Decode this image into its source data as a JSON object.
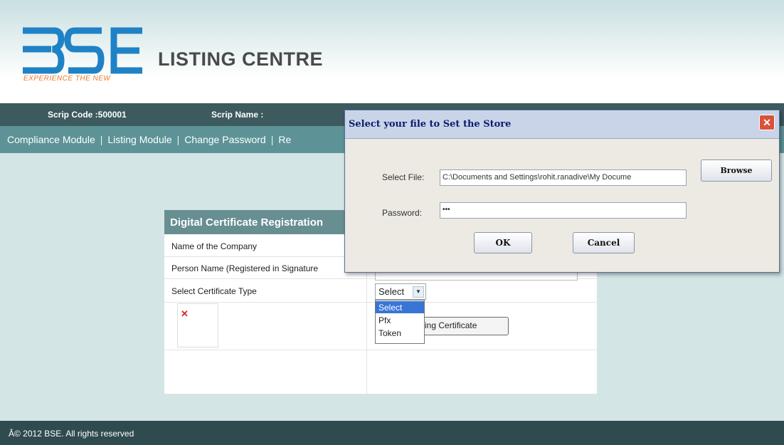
{
  "header": {
    "logo_tagline": "EXPERIENCE THE NEW",
    "title": "LISTING CENTRE"
  },
  "infobar": {
    "scrip_code": "Scrip Code :500001",
    "scrip_name": "Scrip Name :"
  },
  "nav": {
    "items": [
      "Compliance Module",
      "Listing Module",
      "Change Password",
      "Re"
    ],
    "separator": "|"
  },
  "form": {
    "title": "Digital Certificate Registration",
    "rows": [
      "Name of the Company",
      "Person Name (Registered in Signature",
      "Select Certificate Type"
    ],
    "select_value": "Select",
    "options": [
      "Select",
      "Pfx",
      "Token"
    ],
    "sign_button_label": "igning Certificate"
  },
  "dialog": {
    "title": "Select your file to Set the Store",
    "file_label": "Select File:",
    "file_value": "C:\\Documents and Settings\\rohit.ranadive\\My Docume",
    "password_label": "Password:",
    "password_value": "•••",
    "browse_label": "Browse",
    "ok_label": "OK",
    "cancel_label": "Cancel"
  },
  "footer": {
    "text": "Â© 2012 BSE. All rights reserved"
  },
  "colors": {
    "brand_blue": "#1f82c6",
    "tagline_orange": "#e67a2e",
    "infobar": "#3d5a5e",
    "navbar": "#5d9396",
    "footer": "#2f4b4f"
  }
}
